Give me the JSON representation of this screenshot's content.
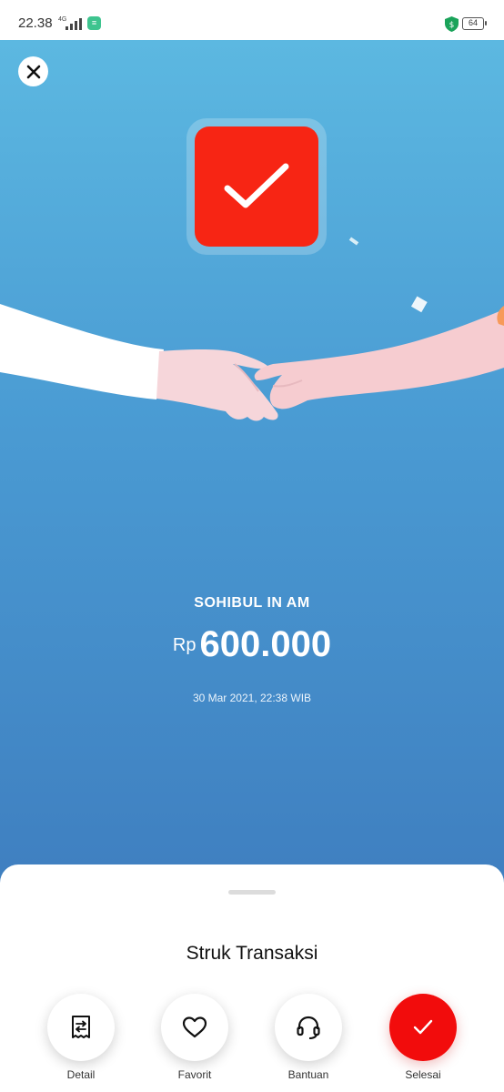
{
  "status_bar": {
    "time": "22.38",
    "network": "4G",
    "battery": "64",
    "icons": [
      "signal-icon",
      "app-notification-icon",
      "shield-icon",
      "battery-icon"
    ]
  },
  "hero": {
    "recipient_name": "SOHIBUL IN AM",
    "currency": "Rp",
    "amount": "600.000",
    "datetime": "30 Mar 2021, 22:38 WIB",
    "colors": {
      "gradient_top": "#5cb8e1",
      "gradient_bottom": "#3f7fc0",
      "success_red": "#f72514"
    }
  },
  "sheet": {
    "title": "Struk Transaksi",
    "actions": [
      {
        "label": "Detail",
        "icon": "receipt-icon"
      },
      {
        "label": "Favorit",
        "icon": "heart-icon"
      },
      {
        "label": "Bantuan",
        "icon": "headset-icon"
      },
      {
        "label": "Selesai",
        "icon": "check-icon"
      }
    ],
    "primary_color": "#f20c0c"
  }
}
